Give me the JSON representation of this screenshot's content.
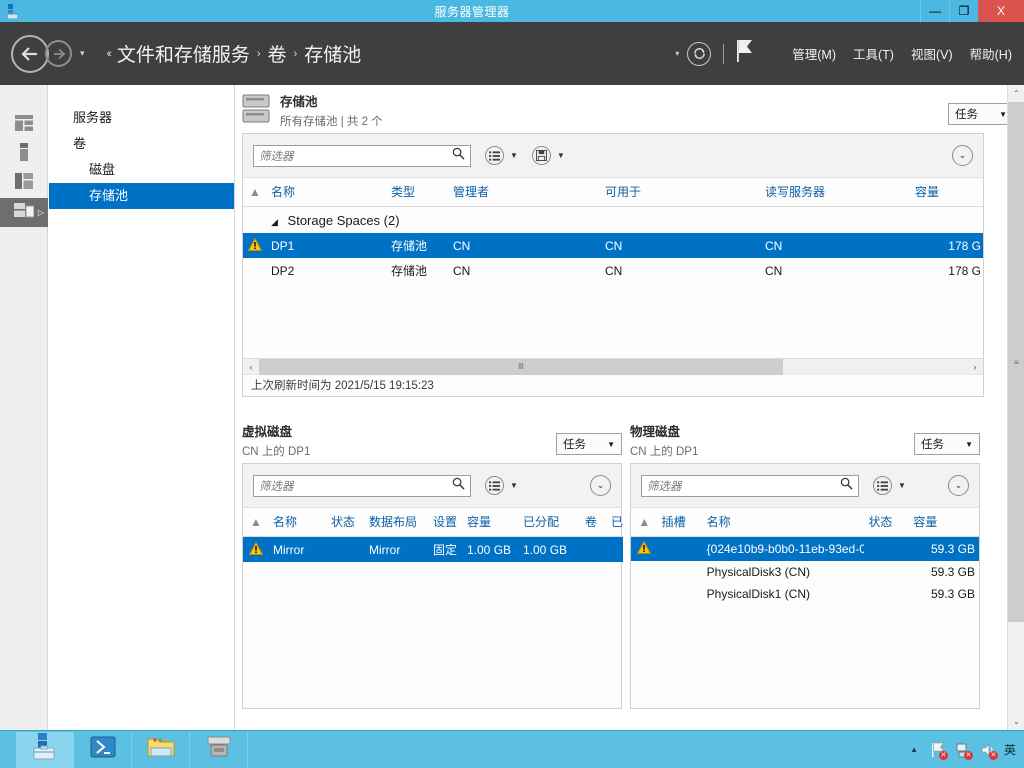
{
  "window": {
    "title": "服务器管理器",
    "icon": "server-manager-icon",
    "minimize_label": "—",
    "maximize_label": "❐",
    "close_label": "X"
  },
  "nav": {
    "back_icon": "back-arrow-icon",
    "forward_icon": "forward-arrow-icon",
    "history_caret": "▾",
    "breadcrumb_lead": "‹‹",
    "breadcrumbs": [
      "文件和存储服务",
      "卷",
      "存储池"
    ],
    "separator": "›",
    "notification_caret": "▾",
    "refresh_icon": "refresh-icon",
    "flag_icon": "flag-notification-icon",
    "menus": [
      "管理(M)",
      "工具(T)",
      "视图(V)",
      "帮助(H)"
    ]
  },
  "rail": {
    "items": [
      {
        "name": "dashboard-icon",
        "active": false
      },
      {
        "name": "local-server-icon",
        "active": false
      },
      {
        "name": "all-servers-icon",
        "active": false
      },
      {
        "name": "file-storage-services-icon",
        "active": true,
        "expander": "▷"
      }
    ]
  },
  "tree": {
    "items": [
      {
        "label": "服务器",
        "indent": false,
        "selected": false
      },
      {
        "label": "卷",
        "indent": false,
        "selected": false
      },
      {
        "label": "磁盘",
        "indent": true,
        "selected": false
      },
      {
        "label": "存储池",
        "indent": true,
        "selected": true
      }
    ]
  },
  "storage_pools": {
    "title": "存储池",
    "subtitle": "所有存储池 | 共 2 个",
    "icon": "storage-pool-icon",
    "tasks_label": "任务",
    "tasks_caret": "▼",
    "filter_placeholder": "筛选器",
    "search_icon": "search-icon",
    "view_icon": "list-view-icon",
    "save_icon": "save-query-icon",
    "caret": "▼",
    "expand_chevron": "⌄",
    "columns": [
      "名称",
      "类型",
      "管理者",
      "可用于",
      "读写服务器",
      "容量"
    ],
    "sort_indicator": "▲",
    "warn_col_icon": "warning-column-icon",
    "group": {
      "label": "Storage Spaces (2)",
      "expander": "◢"
    },
    "rows": [
      {
        "warning": true,
        "selected": true,
        "name": "DP1",
        "type": "存储池",
        "manager": "CN",
        "available_to": "CN",
        "rw_server": "CN",
        "capacity": "178 G"
      },
      {
        "warning": false,
        "selected": false,
        "name": "DP2",
        "type": "存储池",
        "manager": "CN",
        "available_to": "CN",
        "rw_server": "CN",
        "capacity": "178 G"
      }
    ],
    "hscroll_left": "‹",
    "hscroll_right": "›",
    "hscroll_grip": "lll",
    "status": "上次刷新时间为 2021/5/15 19:15:23"
  },
  "virtual_disks": {
    "title": "虚拟磁盘",
    "subtitle": "CN 上的 DP1",
    "tasks_label": "任务",
    "tasks_caret": "▼",
    "filter_placeholder": "筛选器",
    "search_icon": "search-icon",
    "view_icon": "list-view-icon",
    "caret": "▼",
    "expand_chevron": "⌄",
    "sort_indicator": "▲",
    "columns": [
      "名称",
      "状态",
      "数据布局",
      "设置",
      "容量",
      "已分配",
      "卷",
      "已"
    ],
    "rows": [
      {
        "warning": true,
        "selected": true,
        "name": "Mirror",
        "status": "",
        "layout": "Mirror",
        "provisioning": "固定",
        "capacity": "1.00 GB",
        "allocated": "1.00 GB",
        "volume": "",
        "used": ""
      }
    ]
  },
  "physical_disks": {
    "title": "物理磁盘",
    "subtitle": "CN 上的 DP1",
    "tasks_label": "任务",
    "tasks_caret": "▼",
    "filter_placeholder": "筛选器",
    "search_icon": "search-icon",
    "view_icon": "list-view-icon",
    "caret": "▼",
    "expand_chevron": "⌄",
    "sort_indicator": "▲",
    "columns": [
      "插槽",
      "名称",
      "状态",
      "容量"
    ],
    "rows": [
      {
        "warning": true,
        "selected": true,
        "slot": "",
        "name": "{024e10b9-b0b0-11eb-93ed-0...",
        "status": "",
        "capacity": "59.3 GB"
      },
      {
        "warning": false,
        "selected": false,
        "slot": "",
        "name": "PhysicalDisk3 (CN)",
        "status": "",
        "capacity": "59.3 GB"
      },
      {
        "warning": false,
        "selected": false,
        "slot": "",
        "name": "PhysicalDisk1 (CN)",
        "status": "",
        "capacity": "59.3 GB"
      }
    ]
  },
  "scrollbar": {
    "up_arrow": "⌃",
    "down_arrow": "⌄",
    "grip": "≡"
  },
  "taskbar": {
    "apps": [
      {
        "name": "server-manager-taskbar-icon",
        "active": true
      },
      {
        "name": "powershell-taskbar-icon",
        "active": false
      },
      {
        "name": "explorer-taskbar-icon",
        "active": false
      },
      {
        "name": "disk-tool-taskbar-icon",
        "active": false
      }
    ],
    "tray": {
      "show_hidden_caret": "▲",
      "icons": [
        "flag-alert-icon",
        "network-alert-icon",
        "volume-mute-icon"
      ],
      "ime_label": "英"
    }
  },
  "colors": {
    "accent_blue": "#0072c6",
    "title_cyan": "#4ab8e0",
    "nav_dark": "#3f3f3f",
    "close_red": "#d9534f",
    "warning_amber": "#e8a000",
    "header_link": "#0b5fa8"
  }
}
